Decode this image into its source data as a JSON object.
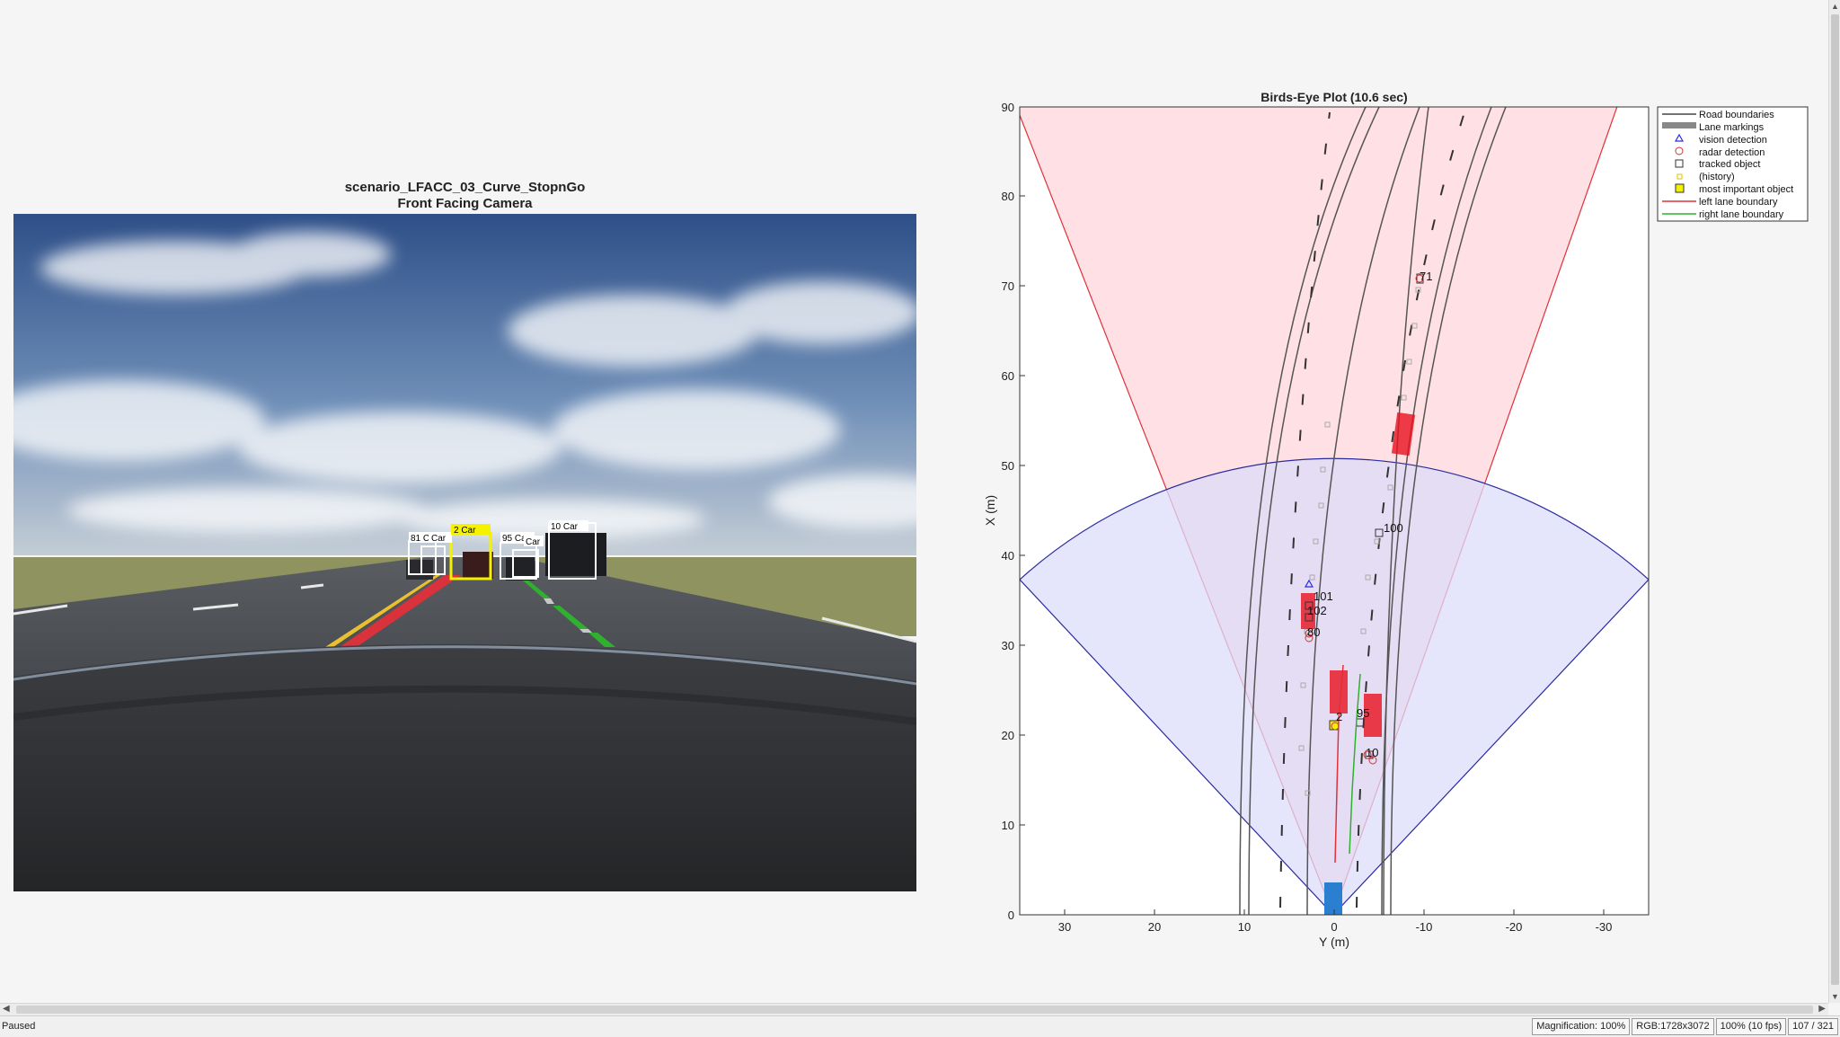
{
  "camera": {
    "scenario": "scenario_LFACC_03_Curve_StopnGo",
    "subtitle": "Front Facing Camera",
    "detections": [
      {
        "label": "81 Car"
      },
      {
        "label": "Car"
      },
      {
        "label": "2 Car"
      },
      {
        "label": "95 Car"
      },
      {
        "label": "Car"
      },
      {
        "label": "10 Car"
      }
    ]
  },
  "bev": {
    "title": "Birds-Eye Plot (10.6 sec)",
    "xlabel": "Y (m)",
    "ylabel": "X (m)",
    "xticks": [
      "30",
      "20",
      "10",
      "0",
      "-10",
      "-20",
      "-30"
    ],
    "yticks": [
      "0",
      "10",
      "20",
      "30",
      "40",
      "50",
      "60",
      "70",
      "80",
      "90"
    ],
    "track_labels": [
      {
        "id": "71"
      },
      {
        "id": "100"
      },
      {
        "id": "101"
      },
      {
        "id": "102"
      },
      {
        "id": "80"
      },
      {
        "id": "2"
      },
      {
        "id": "95"
      },
      {
        "id": "10"
      }
    ],
    "legend": [
      {
        "label": "Road boundaries"
      },
      {
        "label": "Lane markings"
      },
      {
        "label": "vision detection"
      },
      {
        "label": "radar detection"
      },
      {
        "label": "tracked object"
      },
      {
        "label": "(history)"
      },
      {
        "label": "most important object"
      },
      {
        "label": "left lane boundary"
      },
      {
        "label": "right lane boundary"
      }
    ]
  },
  "status": {
    "state": "Paused",
    "magnification": "Magnification: 100%",
    "rgb": "RGB:1728x3072",
    "fps": "100% (10 fps)",
    "frame": "107 / 321"
  },
  "colors": {
    "left_lane": "#e0303a",
    "right_lane": "#2fb02f",
    "radar_coverage": "#ffe0e4",
    "vision_coverage": "#dcdcfa",
    "most_important": "#f5f200"
  }
}
